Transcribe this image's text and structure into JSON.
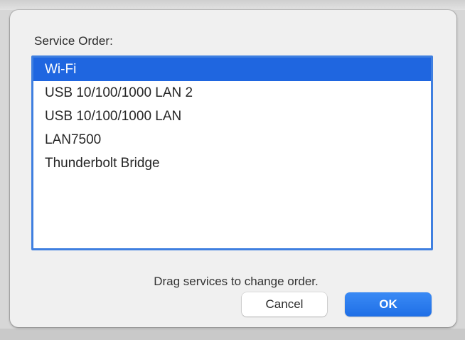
{
  "dialog": {
    "title": "Service Order:",
    "services": [
      {
        "label": "Wi-Fi",
        "selected": true
      },
      {
        "label": "USB 10/100/1000 LAN 2",
        "selected": false
      },
      {
        "label": "USB 10/100/1000 LAN",
        "selected": false
      },
      {
        "label": "LAN7500",
        "selected": false
      },
      {
        "label": "Thunderbolt Bridge",
        "selected": false
      }
    ],
    "hint": "Drag services to change order.",
    "cancel_label": "Cancel",
    "ok_label": "OK"
  },
  "colors": {
    "accent": "#1f66e0",
    "focus_ring": "#3f7fe0",
    "dialog_bg": "#f0f0f0"
  }
}
